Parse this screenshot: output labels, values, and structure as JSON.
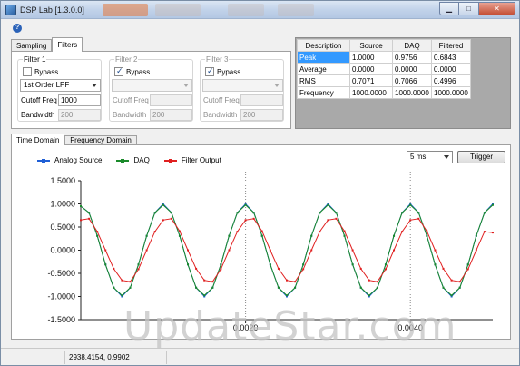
{
  "window": {
    "title": "DSP Lab [1.3.0.0]",
    "controls": {
      "minimize": "▁",
      "maximize": "□",
      "close": "✕"
    }
  },
  "top_tabs": [
    "Sampling",
    "Filters"
  ],
  "filters": [
    {
      "title": "Filter 1",
      "bypass_label": "Bypass",
      "bypass_checked": false,
      "type_value": "1st Order LPF",
      "cutoff_label": "Cutoff Freq",
      "cutoff_value": "1000",
      "bandwidth_label": "Bandwidth",
      "bandwidth_value": "200",
      "enabled": true
    },
    {
      "title": "Filter 2",
      "bypass_label": "Bypass",
      "bypass_checked": true,
      "type_value": "",
      "cutoff_label": "Cutoff Freq",
      "cutoff_value": "",
      "bandwidth_label": "Bandwidth",
      "bandwidth_value": "200",
      "enabled": false
    },
    {
      "title": "Filter 3",
      "bypass_label": "Bypass",
      "bypass_checked": true,
      "type_value": "",
      "cutoff_label": "Cutoff Freq",
      "cutoff_value": "",
      "bandwidth_label": "Bandwidth",
      "bandwidth_value": "200",
      "enabled": false
    }
  ],
  "stats": {
    "headers": [
      "Description",
      "Source",
      "DAQ",
      "Filtered"
    ],
    "rows": [
      [
        "Peak",
        "1.0000",
        "0.9756",
        "0.6843"
      ],
      [
        "Average",
        "0.0000",
        "0.0000",
        "0.0000"
      ],
      [
        "RMS",
        "0.7071",
        "0.7066",
        "0.4996"
      ],
      [
        "Frequency",
        "1000.0000",
        "1000.0000",
        "1000.0000"
      ]
    ],
    "selected_cell": "Peak"
  },
  "bottom_tabs": [
    "Time Domain",
    "Frequency Domain"
  ],
  "controls": {
    "timebase_value": "5 ms",
    "trigger_label": "Trigger"
  },
  "status": {
    "coordinates": "2938.4154, 0.9902"
  },
  "watermark": "UpdateStar.com",
  "colors": {
    "analog_source": "#1f5fd6",
    "daq": "#1a8a2a",
    "filter_output": "#e02020"
  },
  "chart_data": {
    "type": "line",
    "xlim": [
      0,
      0.005
    ],
    "ylim": [
      -1.5,
      1.5
    ],
    "yticks": [
      "1.5000",
      "1.0000",
      "0.5000",
      "0.0000",
      "-0.5000",
      "-1.0000",
      "-1.5000"
    ],
    "xtick_labels": [
      {
        "value": 0.002,
        "label": "0.0020"
      },
      {
        "value": 0.004,
        "label": "0.0040"
      }
    ],
    "grid": false,
    "legend_position": "top-left",
    "series": [
      {
        "name": "Analog Source",
        "color": "#1f5fd6",
        "x": [
          0.0,
          0.0001,
          0.0002,
          0.0003,
          0.0004,
          0.0005,
          0.0006,
          0.0007,
          0.0008,
          0.0009,
          0.001,
          0.0011,
          0.0012,
          0.0013,
          0.0014,
          0.0015,
          0.0016,
          0.0017,
          0.0018,
          0.0019,
          0.002,
          0.0021,
          0.0022,
          0.0023,
          0.0024,
          0.0025,
          0.0026,
          0.0027,
          0.0028,
          0.0029,
          0.003,
          0.0031,
          0.0032,
          0.0033,
          0.0034,
          0.0035,
          0.0036,
          0.0037,
          0.0038,
          0.0039,
          0.004,
          0.0041,
          0.0042,
          0.0043,
          0.0044,
          0.0045,
          0.0046,
          0.0047,
          0.0048,
          0.0049,
          0.005
        ],
        "y": [
          0.951,
          0.809,
          0.309,
          -0.309,
          -0.809,
          -1.0,
          -0.809,
          -0.309,
          0.309,
          0.809,
          1.0,
          0.809,
          0.309,
          -0.309,
          -0.809,
          -1.0,
          -0.809,
          -0.309,
          0.309,
          0.809,
          1.0,
          0.809,
          0.309,
          -0.309,
          -0.809,
          -1.0,
          -0.809,
          -0.309,
          0.309,
          0.809,
          1.0,
          0.809,
          0.309,
          -0.309,
          -0.809,
          -1.0,
          -0.809,
          -0.309,
          0.309,
          0.809,
          1.0,
          0.809,
          0.309,
          -0.309,
          -0.809,
          -1.0,
          -0.809,
          -0.309,
          0.309,
          0.809,
          1.0
        ]
      },
      {
        "name": "DAQ",
        "color": "#1a8a2a",
        "x": [
          0.0,
          0.0001,
          0.0002,
          0.0003,
          0.0004,
          0.0005,
          0.0006,
          0.0007,
          0.0008,
          0.0009,
          0.001,
          0.0011,
          0.0012,
          0.0013,
          0.0014,
          0.0015,
          0.0016,
          0.0017,
          0.0018,
          0.0019,
          0.002,
          0.0021,
          0.0022,
          0.0023,
          0.0024,
          0.0025,
          0.0026,
          0.0027,
          0.0028,
          0.0029,
          0.003,
          0.0031,
          0.0032,
          0.0033,
          0.0034,
          0.0035,
          0.0036,
          0.0037,
          0.0038,
          0.0039,
          0.004,
          0.0041,
          0.0042,
          0.0043,
          0.0044,
          0.0045,
          0.0046,
          0.0047,
          0.0048,
          0.0049,
          0.005
        ],
        "y": [
          0.951,
          0.809,
          0.309,
          -0.309,
          -0.809,
          -0.976,
          -0.809,
          -0.309,
          0.309,
          0.809,
          0.976,
          0.809,
          0.309,
          -0.309,
          -0.809,
          -0.976,
          -0.809,
          -0.309,
          0.309,
          0.809,
          0.976,
          0.809,
          0.309,
          -0.309,
          -0.809,
          -0.976,
          -0.809,
          -0.309,
          0.309,
          0.809,
          0.976,
          0.809,
          0.309,
          -0.309,
          -0.809,
          -0.976,
          -0.809,
          -0.309,
          0.309,
          0.809,
          0.976,
          0.809,
          0.309,
          -0.309,
          -0.809,
          -0.976,
          -0.809,
          -0.309,
          0.309,
          0.809,
          0.976
        ]
      },
      {
        "name": "Filter Output",
        "color": "#e02020",
        "x": [
          0.0,
          0.0001,
          0.0002,
          0.0003,
          0.0004,
          0.0005,
          0.0006,
          0.0007,
          0.0008,
          0.0009,
          0.001,
          0.0011,
          0.0012,
          0.0013,
          0.0014,
          0.0015,
          0.0016,
          0.0017,
          0.0018,
          0.0019,
          0.002,
          0.0021,
          0.0022,
          0.0023,
          0.0024,
          0.0025,
          0.0026,
          0.0027,
          0.0028,
          0.0029,
          0.003,
          0.0031,
          0.0032,
          0.0033,
          0.0034,
          0.0035,
          0.0036,
          0.0037,
          0.0038,
          0.0039,
          0.004,
          0.0041,
          0.0042,
          0.0043,
          0.0044,
          0.0045,
          0.0046,
          0.0047,
          0.0048,
          0.0049,
          0.005
        ],
        "y": [
          0.65,
          0.68,
          0.4,
          0.0,
          -0.4,
          -0.65,
          -0.68,
          -0.41,
          0.0,
          0.4,
          0.65,
          0.68,
          0.41,
          0.0,
          -0.4,
          -0.65,
          -0.68,
          -0.41,
          0.0,
          0.4,
          0.65,
          0.68,
          0.41,
          0.0,
          -0.4,
          -0.65,
          -0.68,
          -0.41,
          0.0,
          0.4,
          0.65,
          0.68,
          0.41,
          0.0,
          -0.4,
          -0.65,
          -0.68,
          -0.41,
          0.0,
          0.4,
          0.65,
          0.68,
          0.41,
          0.0,
          -0.4,
          -0.65,
          -0.68,
          -0.41,
          0.0,
          0.4,
          0.38
        ]
      }
    ]
  }
}
